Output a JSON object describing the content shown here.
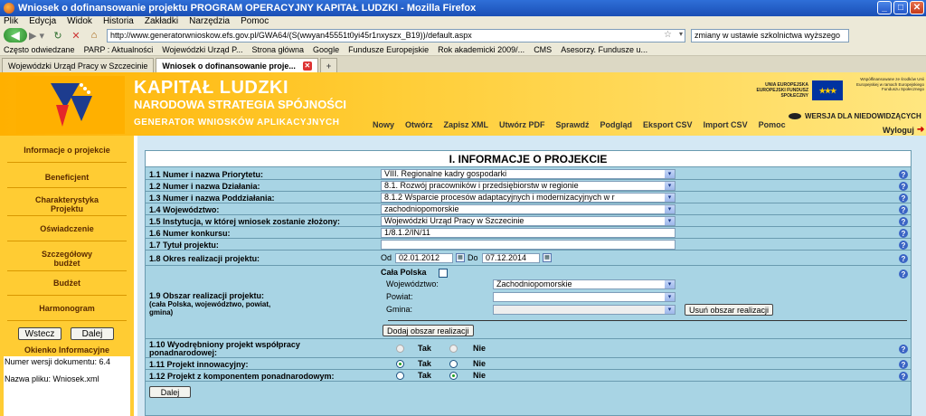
{
  "window": {
    "title": "Wniosek o dofinansowanie projektu PROGRAM OPERACYJNY KAPITAŁ LUDZKI - Mozilla Firefox",
    "btn_min": "_",
    "btn_max": "□",
    "btn_close": "✕"
  },
  "menu": [
    "Plik",
    "Edycja",
    "Widok",
    "Historia",
    "Zakładki",
    "Narzędzia",
    "Pomoc"
  ],
  "nav": {
    "url": "http://www.generatorwnioskow.efs.gov.pl/GWA64/(S(wwyan45551t0yi45r1nxyszx_B19))/default.aspx",
    "search_value": "zmiany w ustawie szkolnictwa wyższego"
  },
  "bookmarks": [
    "Często odwiedzane",
    "PARP : Aktualności",
    "Wojewódzki Urząd P...",
    "Strona główna",
    "Google",
    "Fundusze Europejskie",
    "Rok akademicki 2009/...",
    "CMS",
    "Asesorzy. Fundusze u..."
  ],
  "tabs": [
    {
      "label": "Wojewódzki Urząd Pracy w Szczecinie",
      "active": false
    },
    {
      "label": "Wniosek o dofinansowanie proje...",
      "active": true
    }
  ],
  "header": {
    "title": "KAPITAŁ LUDZKI",
    "subtitle": "NARODOWA STRATEGIA SPÓJNOŚCI",
    "generator": "GENERATOR WNIOSKÓW APLIKACYJNYCH",
    "nav": [
      "Nowy",
      "Otwórz",
      "Zapisz XML",
      "Utwórz PDF",
      "Sprawdź",
      "Podgląd",
      "Eksport CSV",
      "Import CSV",
      "Pomoc"
    ],
    "eu_text": "UNIA EUROPEJSKA EUROPEJSKI FUNDUSZ SPOŁECZNY",
    "right_logo_text": "Współfinansowane ze środków Unii Europejskiej w ramach Europejskiego Funduszu Społecznego",
    "accessible": "WERSJA DLA NIEDOWIDZĄCYCH",
    "logout": "Wyloguj"
  },
  "sidebar": {
    "items": [
      "Informacje o projekcie",
      "Beneficjent",
      "Charakterystyka Projektu",
      "Oświadczenie",
      "Szczegółowy budżet",
      "Budżet",
      "Harmonogram"
    ],
    "back_btn": "Wstecz",
    "next_btn": "Dalej",
    "info_title": "Okienko Informacyjne",
    "info_line1": "Numer wersji dokumentu: 6.4",
    "info_line2": "Nazwa pliku: Wniosek.xml"
  },
  "form": {
    "title": "I. INFORMACJE O PROJEKCIE",
    "help": "?",
    "r1_label": "1.1 Numer i nazwa Priorytetu:",
    "r1_value": "VIII. Regionalne kadry gospodarki",
    "r2_label": "1.2 Numer i nazwa Działania:",
    "r2_value": "8.1. Rozwój pracowników i przedsiębiorstw w regionie",
    "r3_label": "1.3 Numer i nazwa Poddziałania:",
    "r3_value": "8.1.2 Wsparcie procesów adaptacyjnych i modernizacyjnych w r",
    "r4_label": "1.4 Województwo:",
    "r4_value": "zachodniopomorskie",
    "r5_label": "1.5 Instytucja, w której wniosek zostanie złożony:",
    "r5_value": "Wojewódzki Urząd Pracy w Szczecinie",
    "r6_label": "1.6 Numer konkursu:",
    "r6_value": "1/8.1.2/IN/11",
    "r7_label": "1.7 Tytuł projektu:",
    "r7_value": "",
    "r8_label": "1.8 Okres realizacji projektu:",
    "r8_od": "Od",
    "r8_from": "02.01.2012",
    "r8_do": "Do",
    "r8_to": "07.12.2014",
    "r9_label": "1.9 Obszar realizacji projektu:",
    "r9_note": "(cała Polska, województwo, powiat, gmina)",
    "r9_all_poland": "Cała Polska",
    "r9_voiv_label": "Województwo:",
    "r9_voiv_value": "Zachodniopomorskie",
    "r9_powiat_label": "Powiat:",
    "r9_gmina_label": "Gmina:",
    "r9_remove_btn": "Usuń obszar realizacji",
    "r9_add_btn": "Dodaj obszar realizacji",
    "r10_label": "1.10 Wyodrębniony projekt współpracy ponadnarodowej:",
    "r11_label": "1.11 Projekt innowacyjny:",
    "r12_label": "1.12 Projekt z komponentem ponadnarodowym:",
    "yes": "Tak",
    "no": "Nie",
    "next_btn": "Dalej"
  }
}
